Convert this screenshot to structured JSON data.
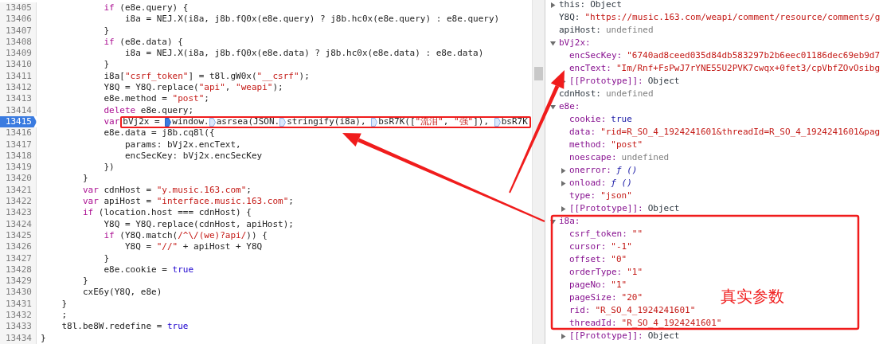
{
  "code": {
    "lines": [
      {
        "number": "13405",
        "current": false,
        "segments": [
          {
            "kind": "keyword",
            "text": "            if"
          },
          {
            "kind": "plain",
            "text": " (e8e.query) {"
          }
        ]
      },
      {
        "number": "13406",
        "current": false,
        "segments": [
          {
            "kind": "plain",
            "text": "                i8a = NEJ.X(i8a, j8b.fQ0x(e8e.query) ? j8b.hc0x(e8e.query) : e8e.query)"
          }
        ]
      },
      {
        "number": "13407",
        "current": false,
        "segments": [
          {
            "kind": "plain",
            "text": "            }"
          }
        ]
      },
      {
        "number": "13408",
        "current": false,
        "segments": [
          {
            "kind": "keyword",
            "text": "            if"
          },
          {
            "kind": "plain",
            "text": " (e8e.data) {"
          }
        ]
      },
      {
        "number": "13409",
        "current": false,
        "segments": [
          {
            "kind": "plain",
            "text": "                i8a = NEJ.X(i8a, j8b.fQ0x(e8e.data) ? j8b.hc0x(e8e.data) : e8e.data)"
          }
        ]
      },
      {
        "number": "13410",
        "current": false,
        "segments": [
          {
            "kind": "plain",
            "text": "            }"
          }
        ]
      },
      {
        "number": "13411",
        "current": false,
        "segments": [
          {
            "kind": "plain",
            "text": "            i8a["
          },
          {
            "kind": "string",
            "text": "\"csrf_token\""
          },
          {
            "kind": "plain",
            "text": "] = t8l.gW0x("
          },
          {
            "kind": "string",
            "text": "\"__csrf\""
          },
          {
            "kind": "plain",
            "text": ");"
          }
        ]
      },
      {
        "number": "13412",
        "current": false,
        "segments": [
          {
            "kind": "plain",
            "text": "            Y8Q = Y8Q.replace("
          },
          {
            "kind": "string",
            "text": "\"api\""
          },
          {
            "kind": "plain",
            "text": ", "
          },
          {
            "kind": "string",
            "text": "\"weapi\""
          },
          {
            "kind": "plain",
            "text": ");"
          }
        ]
      },
      {
        "number": "13413",
        "current": false,
        "segments": [
          {
            "kind": "plain",
            "text": "            e8e.method = "
          },
          {
            "kind": "string",
            "text": "\"post\""
          },
          {
            "kind": "plain",
            "text": ";"
          }
        ]
      },
      {
        "number": "13414",
        "current": false,
        "segments": [
          {
            "kind": "keyword",
            "text": "            delete"
          },
          {
            "kind": "plain",
            "text": " e8e.query;"
          }
        ]
      },
      {
        "number": "13415",
        "current": true,
        "segments": [
          {
            "kind": "keyword",
            "text": "            var"
          }
        ],
        "framed_segments": [
          {
            "kind": "plain",
            "text": "bVj2x = "
          },
          {
            "kind": "breakpoint",
            "filled": true
          },
          {
            "kind": "plain",
            "text": "window."
          },
          {
            "kind": "breakpoint",
            "filled": false
          },
          {
            "kind": "plain",
            "text": "asrsea(JSON."
          },
          {
            "kind": "breakpoint",
            "filled": false
          },
          {
            "kind": "plain",
            "text": "stringify(i8a), "
          },
          {
            "kind": "breakpoint",
            "filled": false
          },
          {
            "kind": "plain",
            "text": "bsR7K(["
          },
          {
            "kind": "string",
            "text": "\"流泪\""
          },
          {
            "kind": "plain",
            "text": ", "
          },
          {
            "kind": "string",
            "text": "\"强\""
          },
          {
            "kind": "plain",
            "text": "]), "
          },
          {
            "kind": "breakpoint",
            "filled": false
          },
          {
            "kind": "plain",
            "text": "bsR7K"
          }
        ]
      },
      {
        "number": "13416",
        "current": false,
        "segments": [
          {
            "kind": "plain",
            "text": "            e8e.data = j8b.cq8l({"
          }
        ]
      },
      {
        "number": "13417",
        "current": false,
        "segments": [
          {
            "kind": "plain",
            "text": "                params: bVj2x.encText,"
          }
        ]
      },
      {
        "number": "13418",
        "current": false,
        "segments": [
          {
            "kind": "plain",
            "text": "                encSecKey: bVj2x.encSecKey"
          }
        ]
      },
      {
        "number": "13419",
        "current": false,
        "segments": [
          {
            "kind": "plain",
            "text": "            })"
          }
        ]
      },
      {
        "number": "13420",
        "current": false,
        "segments": [
          {
            "kind": "plain",
            "text": "        }"
          }
        ]
      },
      {
        "number": "13421",
        "current": false,
        "segments": [
          {
            "kind": "keyword",
            "text": "        var"
          },
          {
            "kind": "plain",
            "text": " cdnHost = "
          },
          {
            "kind": "string",
            "text": "\"y.music.163.com\""
          },
          {
            "kind": "plain",
            "text": ";"
          }
        ]
      },
      {
        "number": "13422",
        "current": false,
        "segments": [
          {
            "kind": "keyword",
            "text": "        var"
          },
          {
            "kind": "plain",
            "text": " apiHost = "
          },
          {
            "kind": "string",
            "text": "\"interface.music.163.com\""
          },
          {
            "kind": "plain",
            "text": ";"
          }
        ]
      },
      {
        "number": "13423",
        "current": false,
        "segments": [
          {
            "kind": "keyword",
            "text": "        if"
          },
          {
            "kind": "plain",
            "text": " (location.host === cdnHost) {"
          }
        ]
      },
      {
        "number": "13424",
        "current": false,
        "segments": [
          {
            "kind": "plain",
            "text": "            Y8Q = Y8Q.replace(cdnHost, apiHost);"
          }
        ]
      },
      {
        "number": "13425",
        "current": false,
        "segments": [
          {
            "kind": "keyword",
            "text": "            if"
          },
          {
            "kind": "plain",
            "text": " (Y8Q.match("
          },
          {
            "kind": "string",
            "text": "/^\\/(we)?api/"
          },
          {
            "kind": "plain",
            "text": ")) {"
          }
        ]
      },
      {
        "number": "13426",
        "current": false,
        "segments": [
          {
            "kind": "plain",
            "text": "                Y8Q = "
          },
          {
            "kind": "string",
            "text": "\"//\""
          },
          {
            "kind": "plain",
            "text": " + apiHost + Y8Q"
          }
        ]
      },
      {
        "number": "13427",
        "current": false,
        "segments": [
          {
            "kind": "plain",
            "text": "            }"
          }
        ]
      },
      {
        "number": "13428",
        "current": false,
        "segments": [
          {
            "kind": "plain",
            "text": "            e8e.cookie = "
          },
          {
            "kind": "literal",
            "text": "true"
          }
        ]
      },
      {
        "number": "13429",
        "current": false,
        "segments": [
          {
            "kind": "plain",
            "text": "        }"
          }
        ]
      },
      {
        "number": "13430",
        "current": false,
        "segments": [
          {
            "kind": "plain",
            "text": "        cxE6y(Y8Q, e8e)"
          }
        ]
      },
      {
        "number": "13431",
        "current": false,
        "segments": [
          {
            "kind": "plain",
            "text": "    }"
          }
        ]
      },
      {
        "number": "13432",
        "current": false,
        "segments": [
          {
            "kind": "plain",
            "text": "    ;"
          }
        ]
      },
      {
        "number": "13433",
        "current": false,
        "segments": [
          {
            "kind": "plain",
            "text": "    t8l.be8W.redefine = "
          },
          {
            "kind": "literal",
            "text": "true"
          }
        ]
      },
      {
        "number": "13434",
        "current": false,
        "segments": [
          {
            "kind": "plain",
            "text": "}"
          }
        ]
      }
    ]
  },
  "scope": [
    {
      "name": "this:",
      "value": "Object",
      "kind": "object",
      "expanded": false
    },
    {
      "name": "Y8Q:",
      "value": "\"https://music.163.com/weapi/comment/resource/comments/g",
      "kind": "string"
    },
    {
      "name": "apiHost:",
      "value": "undefined",
      "kind": "undefined"
    },
    {
      "name": "bVj2x:",
      "expanded": true,
      "children": [
        {
          "name": "encSecKey:",
          "value": "\"6740ad8ceed035d84db583297b2b6eec01186dec69eb9d7",
          "kind": "string"
        },
        {
          "name": "encText:",
          "value": "\"Im/Rnf+FsPwJ7rYNE55U2PVK7cwqx+0fet3/cpVbfZOvOsibg",
          "kind": "string"
        },
        {
          "name": "[[Prototype]]:",
          "value": "Object",
          "kind": "object",
          "expanded": false
        }
      ]
    },
    {
      "name": "cdnHost:",
      "value": "undefined",
      "kind": "undefined"
    },
    {
      "name": "e8e:",
      "expanded": true,
      "children": [
        {
          "name": "cookie:",
          "value": "true",
          "kind": "literal"
        },
        {
          "name": "data:",
          "value": "\"rid=R_SO_4_1924241601&threadId=R_SO_4_1924241601&pag",
          "kind": "string"
        },
        {
          "name": "method:",
          "value": "\"post\"",
          "kind": "string"
        },
        {
          "name": "noescape:",
          "value": "undefined",
          "kind": "undefined"
        },
        {
          "name": "onerror:",
          "value": "ƒ ()",
          "kind": "function",
          "expanded": false
        },
        {
          "name": "onload:",
          "value": "ƒ ()",
          "kind": "function",
          "expanded": false
        },
        {
          "name": "type:",
          "value": "\"json\"",
          "kind": "string"
        },
        {
          "name": "[[Prototype]]:",
          "value": "Object",
          "kind": "object",
          "expanded": false
        }
      ]
    },
    {
      "name": "i8a:",
      "expanded": true,
      "children": [
        {
          "name": "csrf_token:",
          "value": "\"\"",
          "kind": "string"
        },
        {
          "name": "cursor:",
          "value": "\"-1\"",
          "kind": "string"
        },
        {
          "name": "offset:",
          "value": "\"0\"",
          "kind": "string"
        },
        {
          "name": "orderType:",
          "value": "\"1\"",
          "kind": "string"
        },
        {
          "name": "pageNo:",
          "value": "\"1\"",
          "kind": "string"
        },
        {
          "name": "pageSize:",
          "value": "\"20\"",
          "kind": "string"
        },
        {
          "name": "rid:",
          "value": "\"R_SO_4_1924241601\"",
          "kind": "string"
        },
        {
          "name": "threadId:",
          "value": "\"R_SO_4_1924241601\"",
          "kind": "string"
        },
        {
          "name": "[[Prototype]]:",
          "value": "Object",
          "kind": "object",
          "expanded": false
        }
      ]
    }
  ],
  "annotation": {
    "label": "真实参数"
  }
}
